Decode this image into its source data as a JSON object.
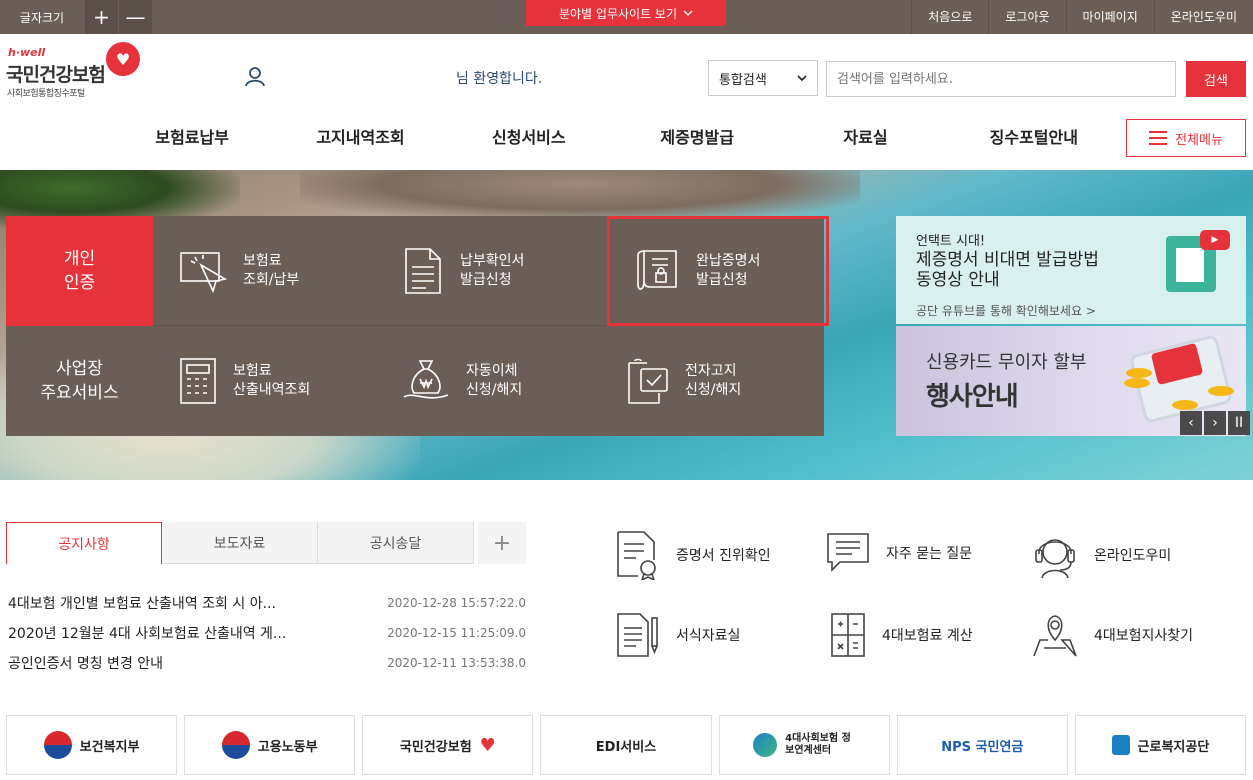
{
  "topbar": {
    "font_size_label": "글자크기",
    "plus": "+",
    "minus": "—",
    "field_site_label": "분야별 업무사이트 보기",
    "links": [
      "처음으로",
      "로그아웃",
      "마이페이지",
      "온라인도우미"
    ]
  },
  "logo": {
    "brand": "h·well",
    "name": "국민건강보험",
    "sub": "사회보험통합징수포털"
  },
  "header": {
    "welcome": "님 환영합니다.",
    "search_select": "통합검색",
    "search_placeholder": "검색어를 입력하세요.",
    "search_button": "검색",
    "all_menu": "전체메뉴"
  },
  "gnb": [
    "보험료납부",
    "고지내역조회",
    "신청서비스",
    "제증명발급",
    "자료실",
    "징수포털안내"
  ],
  "services": {
    "personal_label": "개인\n인증",
    "biz_label": "사업장\n주요서비스",
    "personal": [
      {
        "l1": "보험료",
        "l2": "조회/납부",
        "icon": "cursor-click-icon"
      },
      {
        "l1": "납부확인서",
        "l2": "발급신청",
        "icon": "document-icon"
      },
      {
        "l1": "완납증명서",
        "l2": "발급신청",
        "icon": "certificate-icon"
      }
    ],
    "biz": [
      {
        "l1": "보험료",
        "l2": "산출내역조회",
        "icon": "calculator-icon"
      },
      {
        "l1": "자동이체",
        "l2": "신청/해지",
        "icon": "money-bag-icon"
      },
      {
        "l1": "전자고지",
        "l2": "신청/해지",
        "icon": "e-notice-icon"
      }
    ]
  },
  "banners": {
    "top_line1": "언택트 시대!",
    "top_line2": "제증명서 비대면 발급방법 동영상 안내",
    "top_line3": "공단 유튜브를 통해 확인해보세요 >",
    "bottom_line1": "신용카드 무이자 할부",
    "bottom_line2": "행사안내",
    "nav": [
      "‹",
      "›",
      "II"
    ]
  },
  "tabs": [
    "공지사항",
    "보도자료",
    "공시송달"
  ],
  "tabs_more": "+",
  "notices": [
    {
      "title": "4대보험 개인별 보험료 산출내역 조회 시 아...",
      "date": "2020-12-28 15:57:22.0"
    },
    {
      "title": "2020년 12월분 4대 사회보험료 산출내역 게...",
      "date": "2020-12-15 11:25:09.0"
    },
    {
      "title": "공인인증서 명칭 변경 안내",
      "date": "2020-12-11 13:53:38.0"
    }
  ],
  "quick": [
    {
      "label": "증명서 진위확인",
      "icon": "certificate-verify-icon"
    },
    {
      "label": "자주 묻는 질문",
      "icon": "faq-icon"
    },
    {
      "label": "온라인도우미",
      "icon": "headset-icon"
    },
    {
      "label": "서식자료실",
      "icon": "form-document-icon"
    },
    {
      "label": "4대보험료 계산",
      "icon": "calculator-icon"
    },
    {
      "label": "4대보험지사찾기",
      "icon": "map-pin-icon"
    }
  ],
  "partners": [
    "보건복지부",
    "고용노동부",
    "국민건강보험",
    "EDI서비스",
    "4대사회보험 정보연계센터",
    "NPS 국민연금",
    "근로복지공단"
  ],
  "colors": {
    "accent": "#e6323b",
    "brown": "#6b5e57"
  }
}
